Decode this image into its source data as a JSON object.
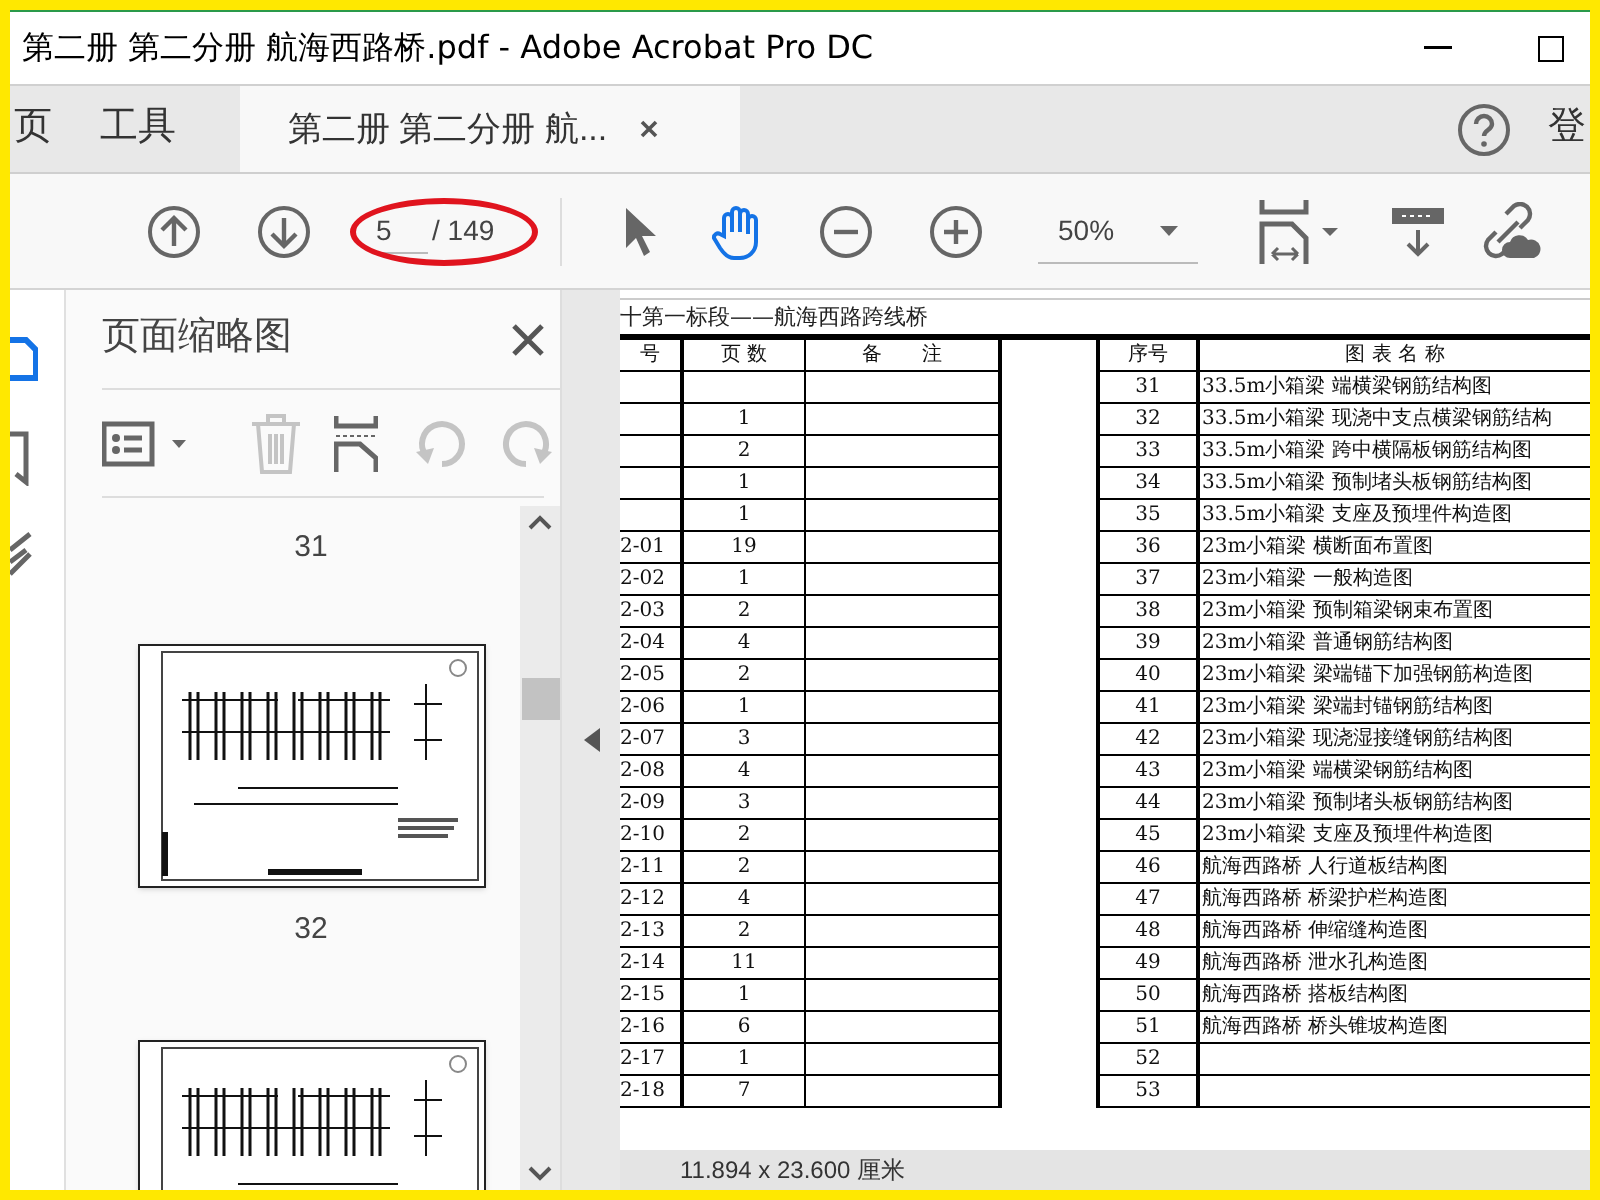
{
  "window": {
    "title": "第二册 第二分册 航海西路桥.pdf - Adobe Acrobat Pro DC"
  },
  "tabs": [
    {
      "label": "页",
      "selected": false
    },
    {
      "label": "工具",
      "selected": false
    },
    {
      "label": "第二册 第二分册 航...",
      "selected": true
    }
  ],
  "sign_in": "登",
  "toolbar": {
    "page_number": "5",
    "page_total": "/ 149",
    "zoom": "50%",
    "tools": [
      {
        "kind": "select",
        "selected": false
      },
      {
        "kind": "hand",
        "selected": true
      }
    ]
  },
  "rail": [
    {
      "kind": "pages",
      "selected": true
    },
    {
      "kind": "bookmarks",
      "selected": false
    },
    {
      "kind": "signature",
      "selected": false
    }
  ],
  "thumbnails": {
    "title": "页面缩略图",
    "delete_disabled": true,
    "rotate_disabled": true,
    "pages": [
      {
        "label": "31"
      },
      {
        "label": "32"
      }
    ]
  },
  "document": {
    "heading": "十第一标段——航海西路跨线桥",
    "left_columns": [
      "号",
      "页 数",
      "备　　注"
    ],
    "right_columns": [
      "序号",
      "图 表 名 称"
    ],
    "rows": [
      {
        "code": "",
        "pages": "",
        "index": "31",
        "name": "33.5m小箱梁 端横梁钢筋结构图"
      },
      {
        "code": "",
        "pages": "1",
        "index": "32",
        "name": "33.5m小箱梁 现浇中支点横梁钢筋结构"
      },
      {
        "code": "",
        "pages": "2",
        "index": "33",
        "name": "33.5m小箱梁 跨中横隔板钢筋结构图"
      },
      {
        "code": "",
        "pages": "1",
        "index": "34",
        "name": "33.5m小箱梁 预制堵头板钢筋结构图"
      },
      {
        "code": "",
        "pages": "1",
        "index": "35",
        "name": "33.5m小箱梁 支座及预埋件构造图"
      },
      {
        "code": "2-01",
        "pages": "19",
        "index": "36",
        "name": "23m小箱梁 横断面布置图"
      },
      {
        "code": "2-02",
        "pages": "1",
        "index": "37",
        "name": "23m小箱梁 一般构造图"
      },
      {
        "code": "2-03",
        "pages": "2",
        "index": "38",
        "name": "23m小箱梁 预制箱梁钢束布置图"
      },
      {
        "code": "2-04",
        "pages": "4",
        "index": "39",
        "name": "23m小箱梁 普通钢筋结构图"
      },
      {
        "code": "2-05",
        "pages": "2",
        "index": "40",
        "name": "23m小箱梁 梁端锚下加强钢筋构造图"
      },
      {
        "code": "2-06",
        "pages": "1",
        "index": "41",
        "name": "23m小箱梁 梁端封锚钢筋结构图"
      },
      {
        "code": "2-07",
        "pages": "3",
        "index": "42",
        "name": "23m小箱梁 现浇湿接缝钢筋结构图"
      },
      {
        "code": "2-08",
        "pages": "4",
        "index": "43",
        "name": "23m小箱梁 端横梁钢筋结构图"
      },
      {
        "code": "2-09",
        "pages": "3",
        "index": "44",
        "name": "23m小箱梁 预制堵头板钢筋结构图"
      },
      {
        "code": "2-10",
        "pages": "2",
        "index": "45",
        "name": "23m小箱梁 支座及预埋件构造图"
      },
      {
        "code": "2-11",
        "pages": "2",
        "index": "46",
        "name": "航海西路桥 人行道板结构图"
      },
      {
        "code": "2-12",
        "pages": "4",
        "index": "47",
        "name": "航海西路桥 桥梁护栏构造图"
      },
      {
        "code": "2-13",
        "pages": "2",
        "index": "48",
        "name": "航海西路桥 伸缩缝构造图"
      },
      {
        "code": "2-14",
        "pages": "11",
        "index": "49",
        "name": "航海西路桥 泄水孔构造图"
      },
      {
        "code": "2-15",
        "pages": "1",
        "index": "50",
        "name": "航海西路桥 搭板结构图"
      },
      {
        "code": "2-16",
        "pages": "6",
        "index": "51",
        "name": "航海西路桥 桥头锥坡构造图"
      },
      {
        "code": "2-17",
        "pages": "1",
        "index": "52",
        "name": ""
      },
      {
        "code": "2-18",
        "pages": "7",
        "index": "53",
        "name": ""
      }
    ]
  },
  "status_bar": "11.894 x 23.600 厘米"
}
